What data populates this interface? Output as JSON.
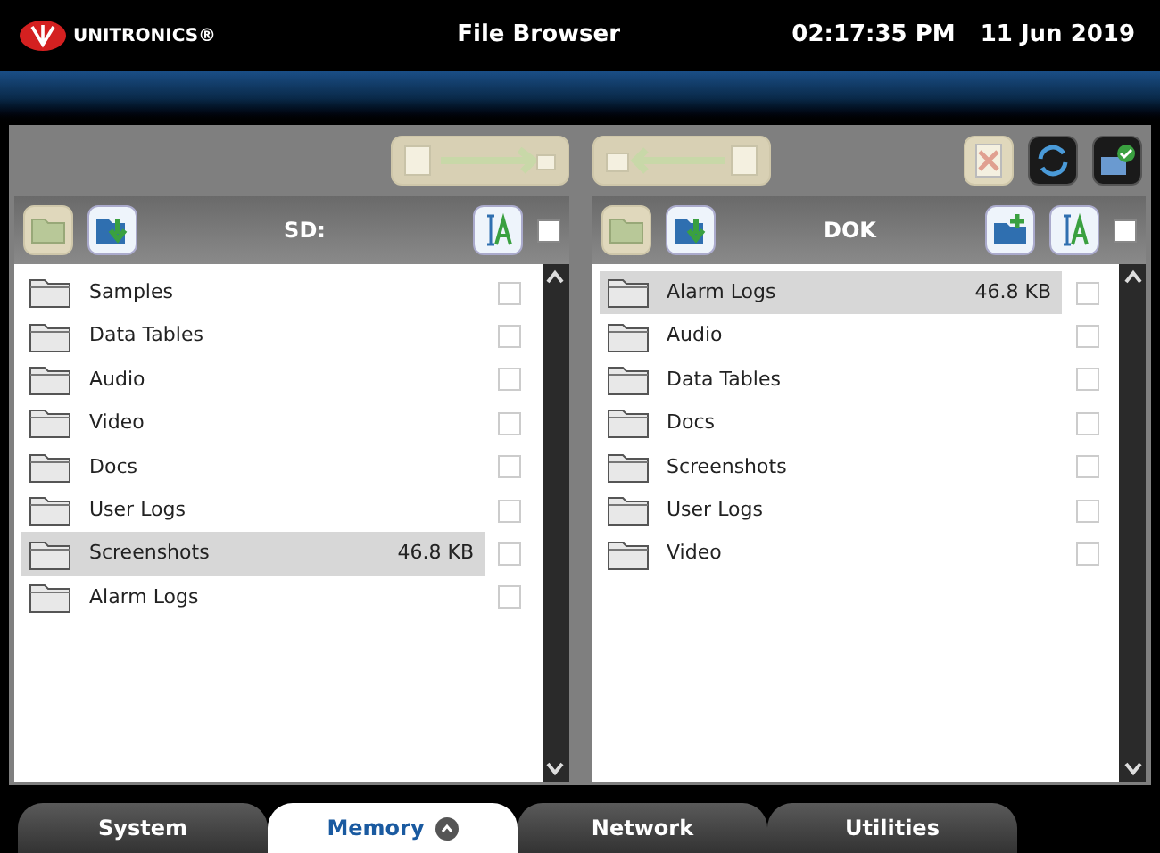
{
  "header": {
    "brand": "UNITRONICS®",
    "title": "File Browser",
    "time": "02:17:35 PM",
    "date": "11 Jun 2019"
  },
  "toolbar": {
    "left": [
      {
        "kind": "copy-right",
        "disabled": true
      }
    ],
    "right": [
      {
        "kind": "copy-left",
        "disabled": true
      }
    ],
    "actions": [
      {
        "kind": "delete",
        "disabled": true
      },
      {
        "kind": "refresh",
        "disabled": false
      },
      {
        "kind": "save",
        "disabled": false
      }
    ]
  },
  "panes": [
    {
      "name": "SD:",
      "buttons": [
        {
          "kind": "open-folder",
          "disabled": true
        },
        {
          "kind": "import",
          "disabled": false
        }
      ],
      "tools": [
        {
          "kind": "sort",
          "disabled": false
        }
      ],
      "checked": false,
      "items": [
        {
          "name": "Samples",
          "selected": false,
          "checked": false
        },
        {
          "name": "Data Tables",
          "selected": false,
          "checked": false
        },
        {
          "name": "Audio",
          "selected": false,
          "checked": false
        },
        {
          "name": "Video",
          "selected": false,
          "checked": false
        },
        {
          "name": "Docs",
          "selected": false,
          "checked": false
        },
        {
          "name": "User Logs",
          "selected": false,
          "checked": false
        },
        {
          "name": "Screenshots",
          "size": "46.8 KB",
          "selected": true,
          "checked": false
        },
        {
          "name": "Alarm Logs",
          "selected": false,
          "checked": false
        }
      ]
    },
    {
      "name": "DOK",
      "buttons": [
        {
          "kind": "open-folder",
          "disabled": true
        },
        {
          "kind": "import",
          "disabled": false
        }
      ],
      "tools": [
        {
          "kind": "new-folder",
          "disabled": false
        },
        {
          "kind": "sort",
          "disabled": false
        }
      ],
      "checked": false,
      "items": [
        {
          "name": "Alarm Logs",
          "size": "46.8 KB",
          "selected": true,
          "checked": false
        },
        {
          "name": "Audio",
          "selected": false,
          "checked": false
        },
        {
          "name": "Data Tables",
          "selected": false,
          "checked": false
        },
        {
          "name": "Docs",
          "selected": false,
          "checked": false
        },
        {
          "name": "Screenshots",
          "selected": false,
          "checked": false
        },
        {
          "name": "User Logs",
          "selected": false,
          "checked": false
        },
        {
          "name": "Video",
          "selected": false,
          "checked": false
        }
      ]
    }
  ],
  "tabs": [
    {
      "label": "System",
      "selected": false
    },
    {
      "label": "Memory",
      "selected": true
    },
    {
      "label": "Network",
      "selected": false
    },
    {
      "label": "Utilities",
      "selected": false
    }
  ]
}
